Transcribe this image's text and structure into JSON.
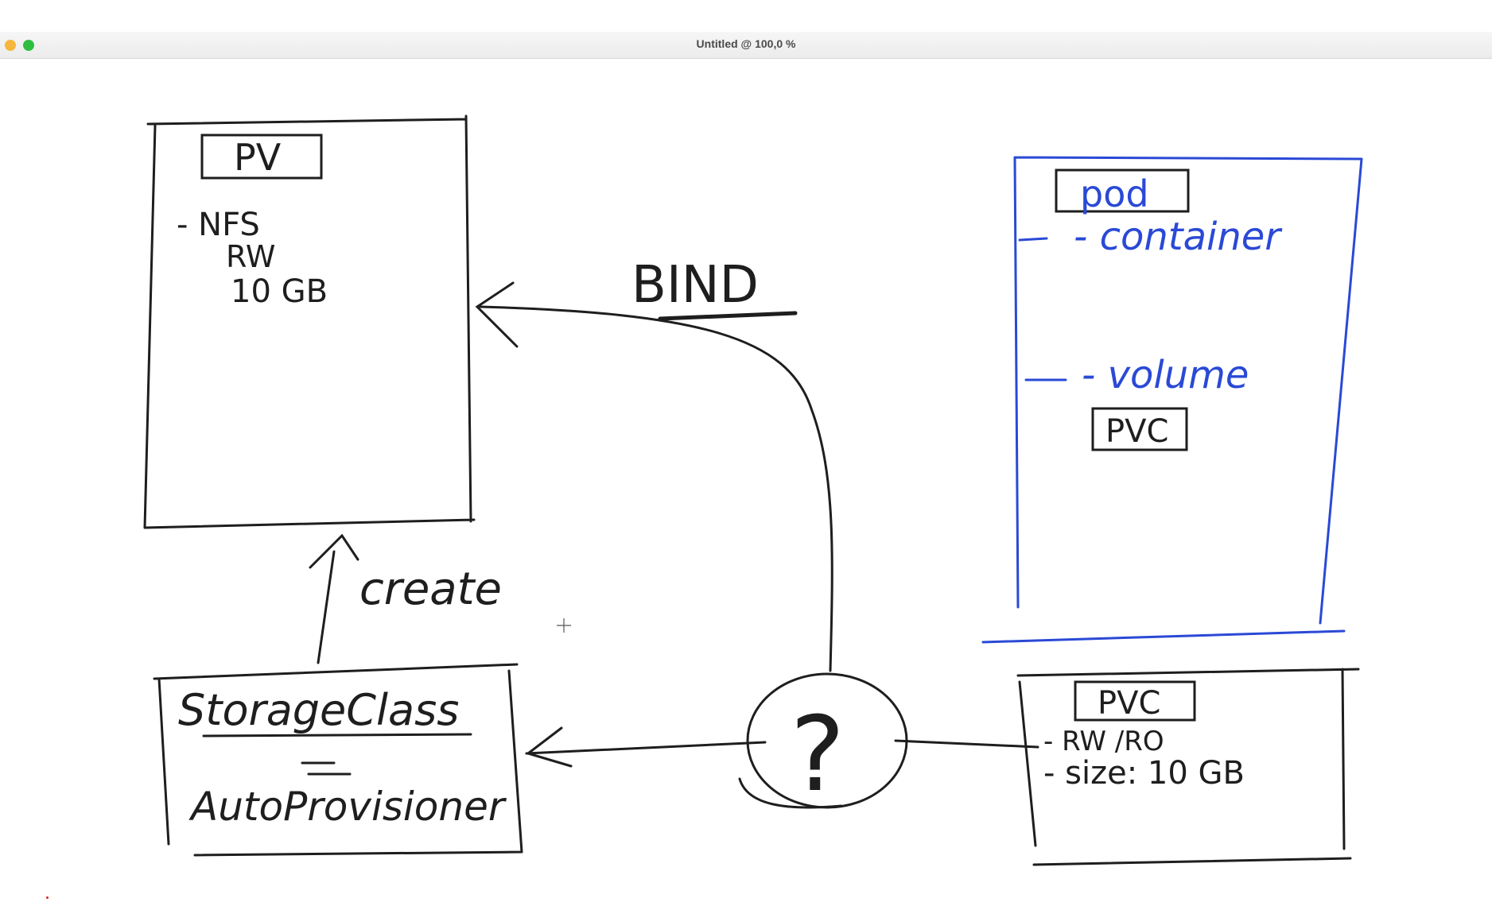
{
  "window": {
    "title": "Untitled @ 100,0 %"
  },
  "board": {
    "pv_box": {
      "title": "PV",
      "lines": [
        "- NFS",
        "RW",
        "10 GB"
      ]
    },
    "pod_box": {
      "title": "pod",
      "container_label": "- container",
      "volume_label": "- volume",
      "pvc_tag": "PVC"
    },
    "bind_label": "BIND",
    "create_label": "create",
    "storage_box": {
      "title": "StorageClass",
      "subtitle": "AutoProvisioner"
    },
    "question_mark": "?",
    "pvc_box": {
      "title": "PVC",
      "lines": [
        "- RW /RO",
        "- size: 10 GB"
      ]
    }
  },
  "colors": {
    "ink": "#1e1e1e",
    "blue_ink": "#2a49d6",
    "red_dot": "#e02020"
  }
}
